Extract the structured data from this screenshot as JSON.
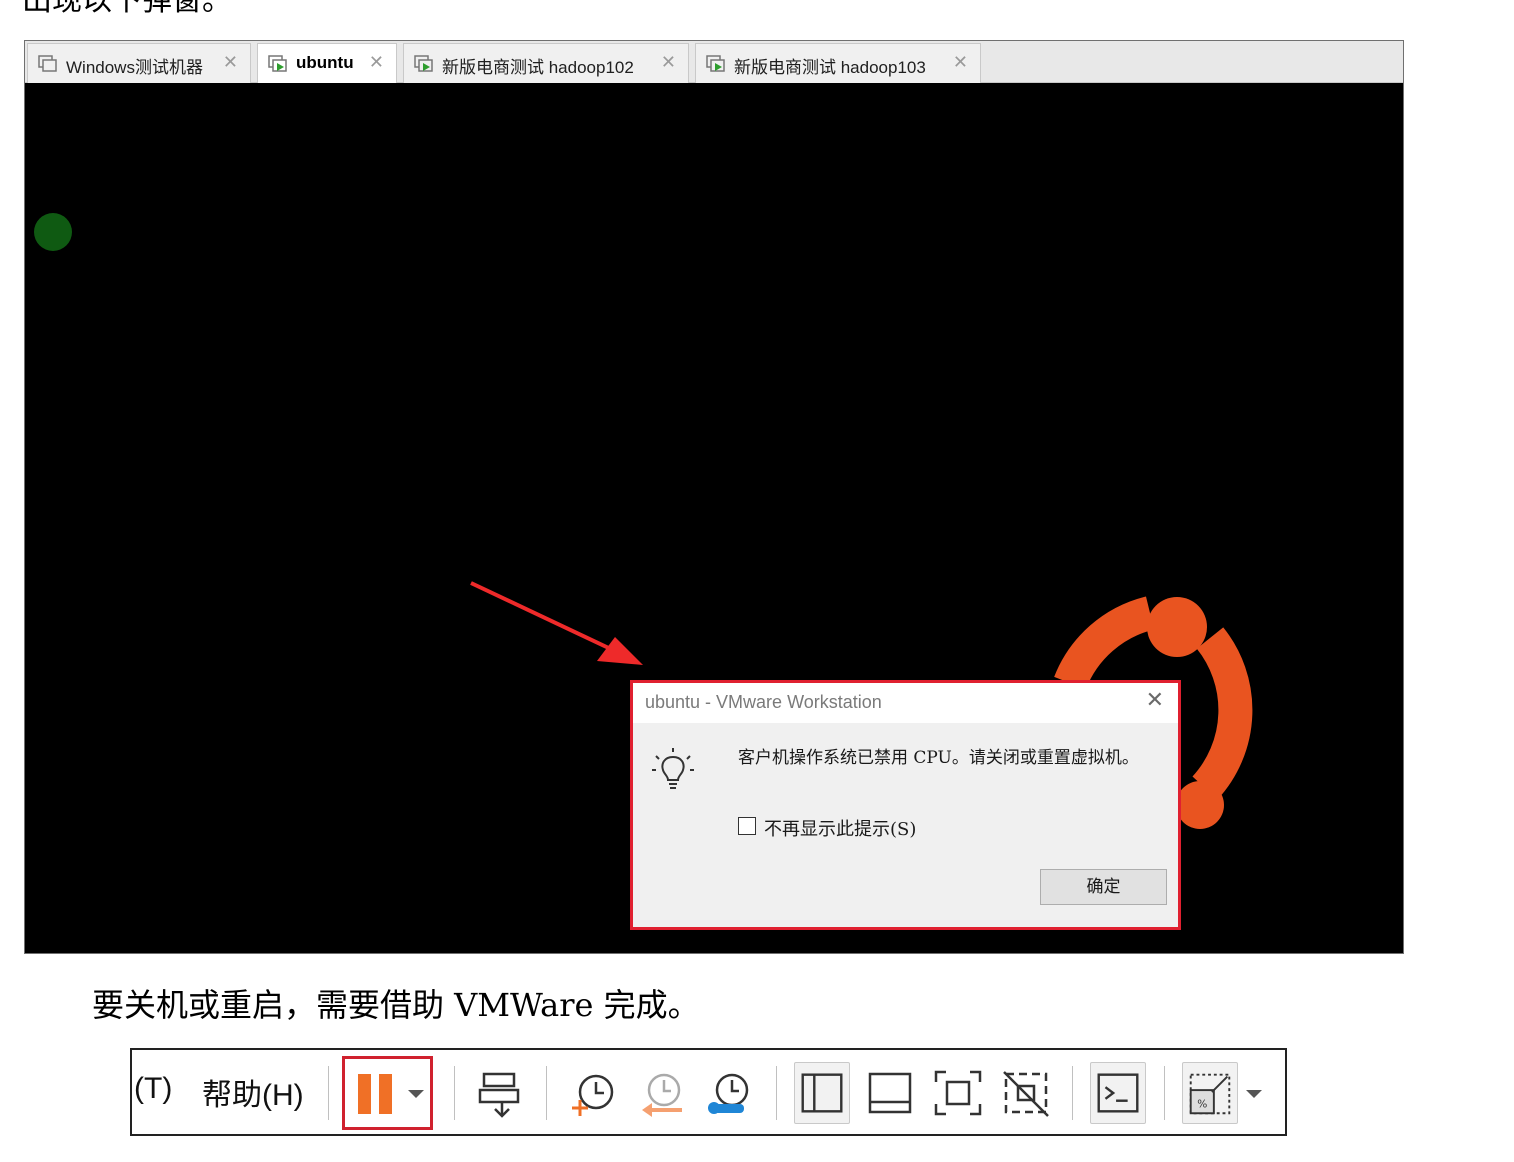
{
  "page": {
    "top_cut_text": "出现以下弹窗。",
    "caption": "要关机或重启，需要借助 VMWare 完成。"
  },
  "tabs": [
    {
      "label": "Windows测试机器",
      "active": false,
      "running": false
    },
    {
      "label": "ubuntu",
      "active": true,
      "running": true
    },
    {
      "label": "新版电商测试 hadoop102",
      "active": false,
      "running": true
    },
    {
      "label": "新版电商测试 hadoop103",
      "active": false,
      "running": true
    }
  ],
  "dialog": {
    "title": "ubuntu - VMware Workstation",
    "message": "客户机操作系统已禁用 CPU。请关闭或重置虚拟机。",
    "checkbox_label": "不再显示此提示(S)",
    "checkbox_checked": false,
    "ok_label": "确定"
  },
  "toolbar": {
    "menu_tools": "(T)",
    "menu_help": "帮助(H)",
    "icons": [
      "pause-icon",
      "dropdown-arrow-icon",
      "send-ctrl-alt-del-icon",
      "snapshot-take-icon",
      "snapshot-revert-icon",
      "snapshot-manager-icon",
      "view-library-icon",
      "view-thumbnail-icon",
      "fullscreen-icon",
      "unity-icon",
      "console-icon",
      "stretch-guest-icon",
      "dropdown-arrow-icon"
    ]
  },
  "colors": {
    "ubuntu_orange": "#e95420",
    "highlight_red": "#d0212e",
    "pause_orange": "#f07026",
    "running_green": "#2e9e2e"
  }
}
